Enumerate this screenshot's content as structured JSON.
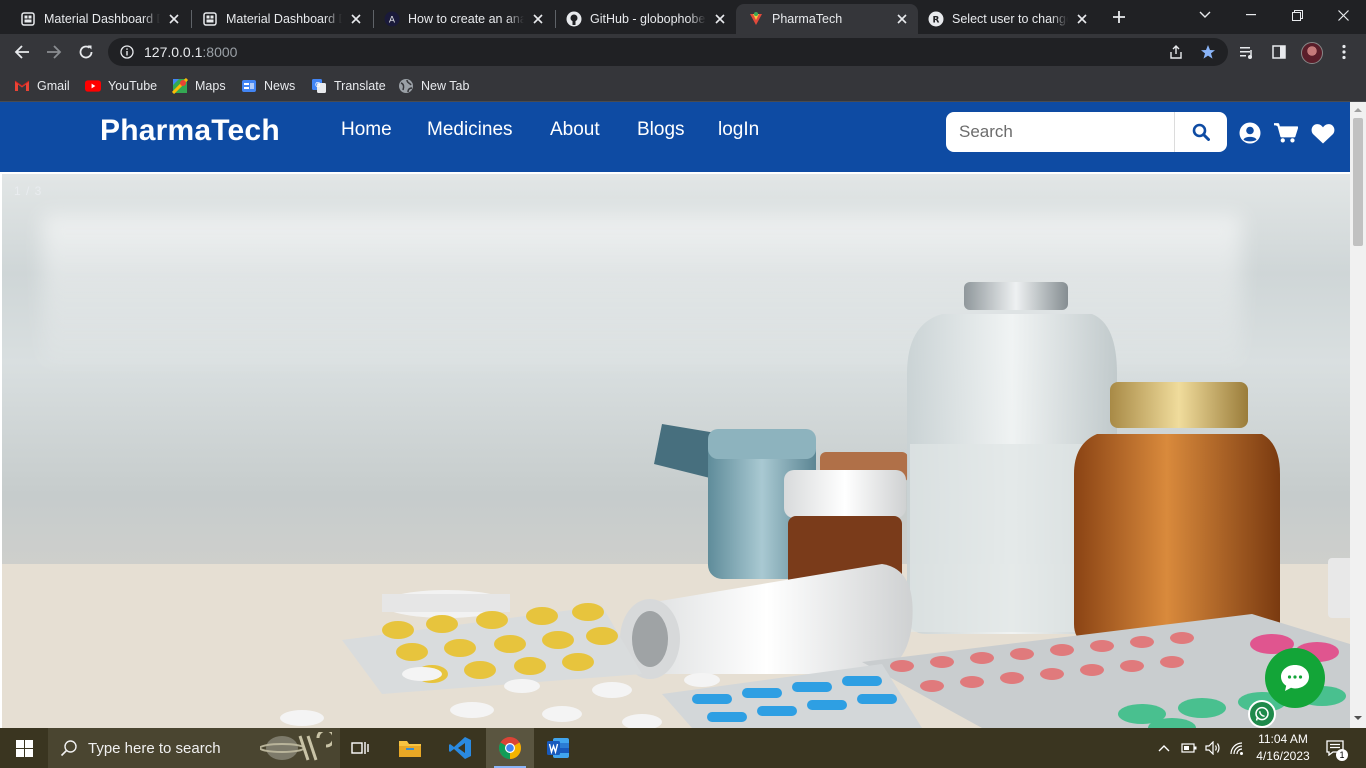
{
  "browser": {
    "tabs": [
      {
        "title": "Material Dashboard Dj",
        "icon": "dashboard-favicon",
        "active": false
      },
      {
        "title": "Material Dashboard Dj",
        "icon": "dashboard-favicon",
        "active": false
      },
      {
        "title": "How to create an anal",
        "icon": "angular-favicon",
        "active": false
      },
      {
        "title": "GitHub - globophobe/",
        "icon": "github-favicon",
        "active": false
      },
      {
        "title": "PharmaTech",
        "icon": "pharmatech-favicon",
        "active": true
      },
      {
        "title": "Select user to change",
        "icon": "django-admin-favicon",
        "active": false
      }
    ],
    "address": {
      "host": "127.0.0.1",
      "port": ":8000"
    },
    "bookmarks": [
      {
        "label": "Gmail",
        "icon": "gmail-icon"
      },
      {
        "label": "YouTube",
        "icon": "youtube-icon"
      },
      {
        "label": "Maps",
        "icon": "maps-icon"
      },
      {
        "label": "News",
        "icon": "news-icon"
      },
      {
        "label": "Translate",
        "icon": "translate-icon"
      },
      {
        "label": "New Tab",
        "icon": "globe-icon"
      }
    ]
  },
  "site": {
    "brand": "PharmaTech",
    "nav": [
      "Home",
      "Medicines",
      "About",
      "Blogs",
      "logIn"
    ],
    "search_placeholder": "Search",
    "icons": [
      "user-icon",
      "cart-icon",
      "heart-icon"
    ],
    "colors": {
      "navbar": "#0e4ba3",
      "chat": "#13a538"
    }
  },
  "hero": {
    "slide_counter": "1 / 3"
  },
  "taskbar": {
    "search_placeholder": "Type here to search",
    "time": "11:04 AM",
    "date": "4/16/2023",
    "notification_count": "1"
  }
}
